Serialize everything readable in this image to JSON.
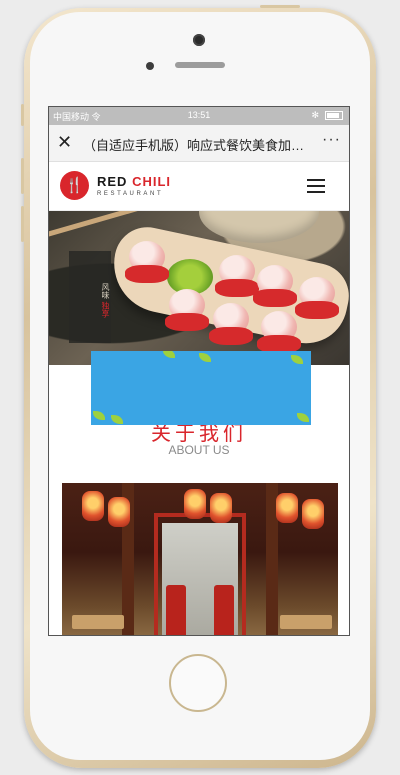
{
  "status_bar": {
    "carrier": "中国移动 令",
    "time": "13:51",
    "bluetooth": "✻"
  },
  "title_bar": {
    "close_icon": "close-icon",
    "title": "（自适应手机版）响应式餐饮美食加盟...",
    "more": "···"
  },
  "site_header": {
    "logo_icon": "fork-knife-icon",
    "logo_glyph": "🍴",
    "brand_first": "RED ",
    "brand_second": "CHILI",
    "brand_sub": "RESTAURANT",
    "menu_icon": "hamburger-icon"
  },
  "hero": {
    "sign_text_1": "风味",
    "sign_text_2": "独享"
  },
  "about": {
    "title_cn": "关于我们",
    "title_en": "ABOUT US"
  },
  "colors": {
    "brand_red": "#d9262c",
    "banner_blue": "#3aa5e4",
    "status_gray": "#bdbdbd"
  }
}
